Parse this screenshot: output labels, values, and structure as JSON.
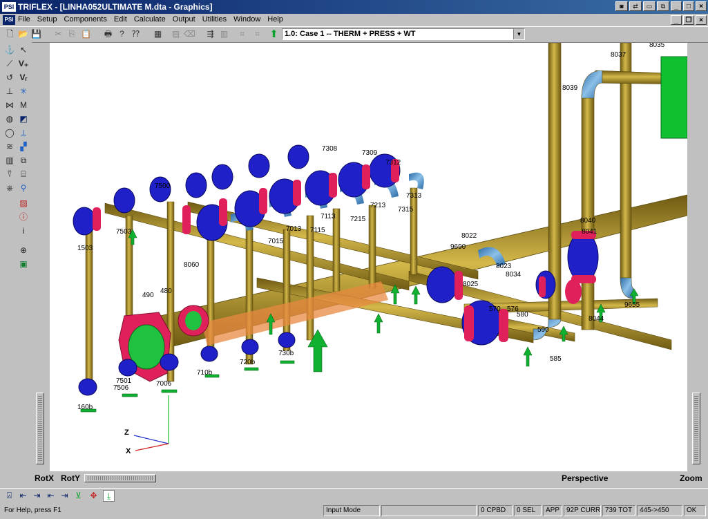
{
  "window": {
    "title": "TRIFLEX - [LINHA052ULTIMATE M.dta - Graphics]",
    "app_icon_text": "PSI"
  },
  "menu": {
    "items": [
      "File",
      "Setup",
      "Components",
      "Edit",
      "Calculate",
      "Output",
      "Utilities",
      "Window",
      "Help"
    ]
  },
  "toolbar": {
    "load_case": "1.0: Case 1 -- THERM + PRESS + WT"
  },
  "view": {
    "rotx_label": "RotX",
    "roty_label": "RotY",
    "mode_label": "Perspective",
    "zoom_label": "Zoom",
    "axis_z": "Z",
    "axis_x": "X",
    "node_labels": [
      "8035",
      "8037",
      "8039",
      "7308",
      "7309",
      "7312",
      "7313",
      "7315",
      "7215",
      "7213",
      "7115",
      "7113",
      "7015",
      "7013",
      "7503",
      "7500",
      "1503",
      "8060",
      "8040",
      "8041",
      "8022",
      "9690",
      "8023",
      "8034",
      "8025",
      "8044",
      "9655",
      "580",
      "576",
      "570",
      "590",
      "585",
      "7501",
      "7506",
      "7006",
      "710b",
      "720b",
      "730b",
      "160b",
      "480",
      "490"
    ]
  },
  "status": {
    "help": "For Help, press F1",
    "mode": "Input Mode",
    "cpbd": "0 CPBD",
    "sel": "0 SEL",
    "app": "APP",
    "curr": "92P CURR",
    "tot": "739 TOT",
    "range": "445->450",
    "ok": "OK"
  },
  "colors": {
    "pipe": "#b8982b",
    "valve": "#2222cc",
    "flange": "#e0205a",
    "support": "#10a030",
    "bend": "#4a90c8",
    "title_bar": "#0a246a"
  }
}
